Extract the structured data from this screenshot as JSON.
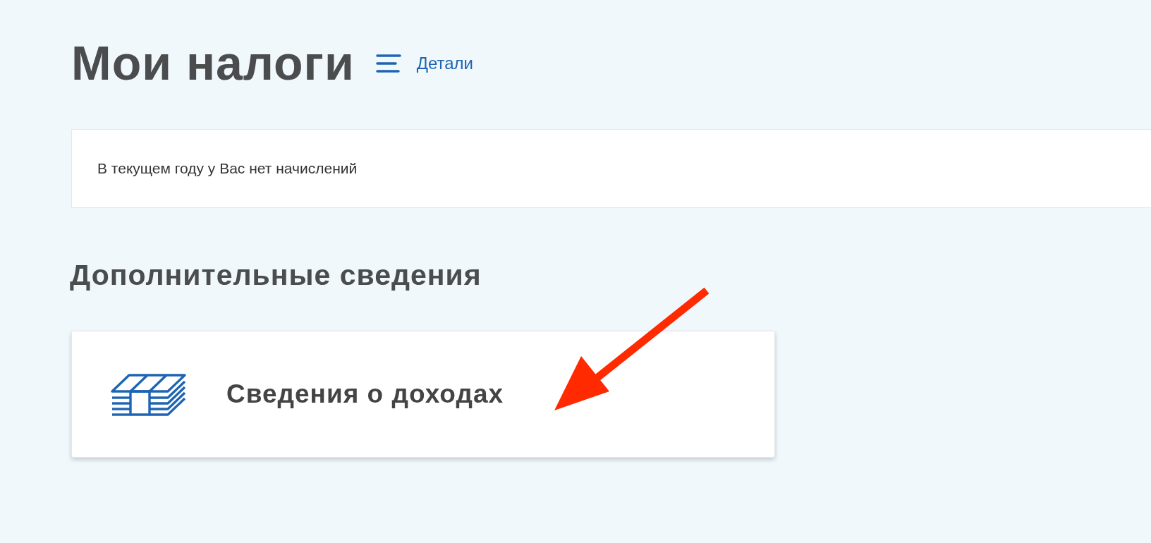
{
  "header": {
    "title": "Мои налоги",
    "details_link": "Детали"
  },
  "notice": {
    "text": "В текущем году у Вас нет начислений"
  },
  "section": {
    "title": "Дополнительные сведения"
  },
  "cards": [
    {
      "label": "Сведения о доходах",
      "kind": "income"
    }
  ],
  "annotation": {
    "kind": "arrow",
    "color": "#ff2a00"
  }
}
